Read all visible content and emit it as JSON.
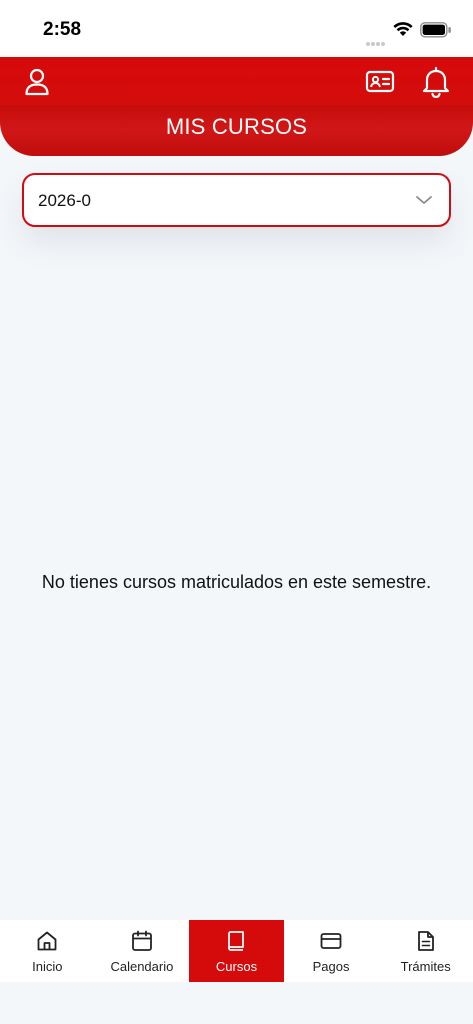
{
  "status": {
    "time": "2:58"
  },
  "header": {
    "title": "MIS CURSOS"
  },
  "semester_select": {
    "selected": "2026-0"
  },
  "empty_message": "No tienes cursos matriculados en este semestre.",
  "nav": {
    "items": [
      {
        "label": "Inicio",
        "icon": "home-icon"
      },
      {
        "label": "Calendario",
        "icon": "calendar-icon"
      },
      {
        "label": "Cursos",
        "icon": "book-icon",
        "active": true
      },
      {
        "label": "Pagos",
        "icon": "credit-card-icon"
      },
      {
        "label": "Trámites",
        "icon": "document-icon"
      }
    ]
  },
  "colors": {
    "brand_red": "#d50a0a",
    "background": "#f4f7fa"
  }
}
